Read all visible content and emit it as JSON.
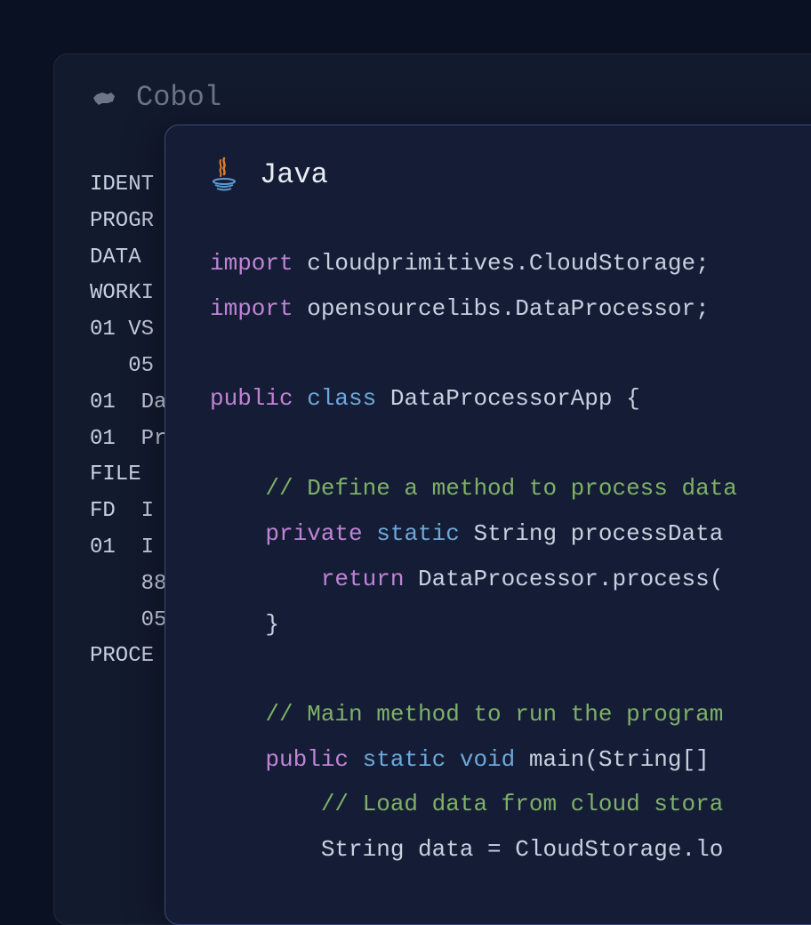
{
  "cobol": {
    "title": "Cobol",
    "lines": [
      "IDENT",
      "PROGR",
      "",
      "DATA ",
      "WORKI",
      "01 VS",
      "   05",
      "01  Da",
      "01  Pr",
      "",
      "FILE ",
      "FD  I",
      "01  I",
      "    88",
      "    05",
      "",
      "PROCE"
    ]
  },
  "java": {
    "title": "Java",
    "code": {
      "import1_kw": "import",
      "import1_val": " cloudprimitives.CloudStorage;",
      "import2_kw": "import",
      "import2_val": " opensourcelibs.DataProcessor;",
      "class_public": "public",
      "class_class": " class",
      "class_name": " DataProcessorApp ",
      "class_brace": "{",
      "comment1": "    // Define a method to process data",
      "method1_private": "    private",
      "method1_static": " static",
      "method1_sig": " String processData",
      "method1_return": "        return",
      "method1_return_val": " DataProcessor.process(",
      "method1_close": "    }",
      "comment2": "    // Main method to run the program",
      "main_public": "    public",
      "main_static": " static",
      "main_void": " void",
      "main_sig": " main(String[] ",
      "comment3": "        // Load data from cloud stora",
      "main_line1": "        String data = CloudStorage.lo"
    }
  }
}
